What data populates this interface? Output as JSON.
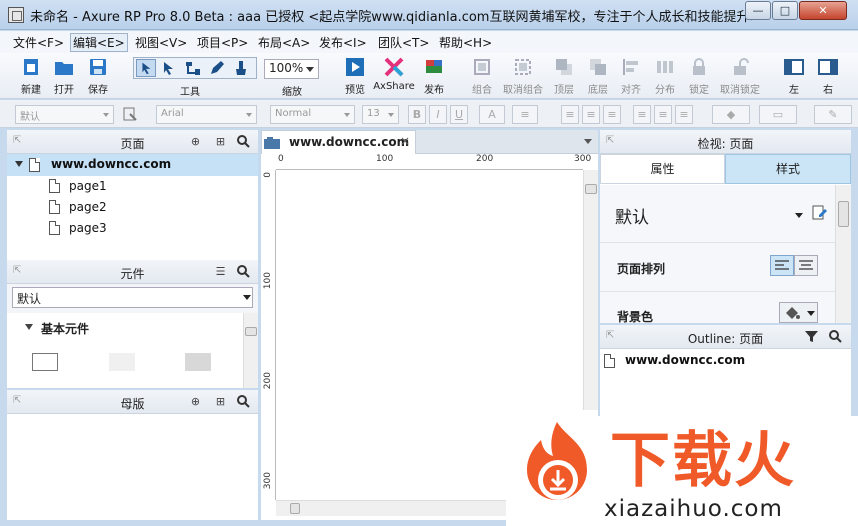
{
  "window": {
    "title": "未命名 - Axure RP Pro 8.0 Beta : aaa 已授权    <起点学院www.qidianla.com互联网黄埔军校，专注于个人成长和技能提升>",
    "controls": {
      "minimize": "—",
      "maximize": "□",
      "close": "✕"
    }
  },
  "menu": [
    "文件<F>",
    "编辑<E>",
    "视图<V>",
    "项目<P>",
    "布局<A>",
    "发布<I>",
    "团队<T>",
    "帮助<H>"
  ],
  "toolbar": {
    "new": "新建",
    "open": "打开",
    "save": "保存",
    "tools": "工具",
    "zoom_value": "100%",
    "zoom": "缩放",
    "preview": "预览",
    "axshare": "AxShare",
    "publish": "发布",
    "group": "组合",
    "ungroup": "取消组合",
    "front": "顶层",
    "back": "底层",
    "align": "对齐",
    "distribute": "分布",
    "lock": "锁定",
    "unlock": "取消锁定",
    "left": "左",
    "right": "右"
  },
  "format_bar": {
    "style": "默认",
    "font": "Arial",
    "weight": "Normal",
    "size": "13"
  },
  "pages_panel": {
    "title": "页面",
    "root": "www.downcc.com",
    "pages": [
      "page1",
      "page2",
      "page3"
    ]
  },
  "widgets_panel": {
    "title": "元件",
    "library": "默认",
    "section": "基本元件"
  },
  "masters_panel": {
    "title": "母版"
  },
  "canvas": {
    "tab": "www.downcc.com",
    "ruler_h": [
      "0",
      "100",
      "200",
      "300"
    ],
    "ruler_v": [
      "0",
      "100",
      "200",
      "300"
    ]
  },
  "inspector": {
    "title": "检视: 页面",
    "tabs": [
      "属性",
      "样式"
    ],
    "style_name": "默认",
    "page_align": "页面排列",
    "bg_color": "背景色"
  },
  "outline": {
    "title": "Outline: 页面",
    "root": "www.downcc.com"
  },
  "watermark": {
    "brand": "下载火",
    "url": "xiazaihuo.com"
  },
  "colors": {
    "accent": "#c6e1f5",
    "brand": "#f05a28"
  }
}
